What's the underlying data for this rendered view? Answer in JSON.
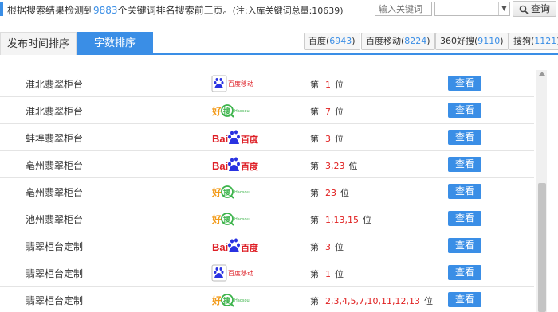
{
  "header": {
    "summary_prefix": "根据搜索结果检测到",
    "keyword_count": "9883",
    "summary_suffix": "个关键词排名搜索前三页。",
    "note": "(注:入库关键词总量:10639)"
  },
  "search": {
    "placeholder": "输入关键词",
    "select_value": "",
    "query_label": "查询"
  },
  "tabs": [
    {
      "label": "发布时间排序",
      "active": false
    },
    {
      "label": "字数排序",
      "active": true
    }
  ],
  "engines": [
    {
      "name": "百度",
      "count": "6943"
    },
    {
      "name": "百度移动",
      "count": "8224"
    },
    {
      "name": "360好搜",
      "count": "9110"
    },
    {
      "name": "搜狗",
      "count": "1121"
    }
  ],
  "rows": [
    {
      "keyword": "淮北翡翠柜台",
      "engine": "baidu-mobile",
      "rank_prefix": "第",
      "positions": "1",
      "rank_suffix": "位",
      "action": "查看"
    },
    {
      "keyword": "淮北翡翠柜台",
      "engine": "haosou",
      "rank_prefix": "第",
      "positions": "7",
      "rank_suffix": "位",
      "action": "查看"
    },
    {
      "keyword": "蚌埠翡翠柜台",
      "engine": "baidu",
      "rank_prefix": "第",
      "positions": "3",
      "rank_suffix": "位",
      "action": "查看"
    },
    {
      "keyword": "亳州翡翠柜台",
      "engine": "baidu",
      "rank_prefix": "第",
      "positions": "3,23",
      "rank_suffix": "位",
      "action": "查看"
    },
    {
      "keyword": "亳州翡翠柜台",
      "engine": "haosou",
      "rank_prefix": "第",
      "positions": "23",
      "rank_suffix": "位",
      "action": "查看"
    },
    {
      "keyword": "池州翡翠柜台",
      "engine": "haosou",
      "rank_prefix": "第",
      "positions": "1,13,15",
      "rank_suffix": "位",
      "action": "查看"
    },
    {
      "keyword": "翡翠柜台定制",
      "engine": "baidu",
      "rank_prefix": "第",
      "positions": "3",
      "rank_suffix": "位",
      "action": "查看"
    },
    {
      "keyword": "翡翠柜台定制",
      "engine": "baidu-mobile",
      "rank_prefix": "第",
      "positions": "1",
      "rank_suffix": "位",
      "action": "查看"
    },
    {
      "keyword": "翡翠柜台定制",
      "engine": "haosou",
      "rank_prefix": "第",
      "positions": "2,3,4,5,7,10,11,12,13",
      "rank_suffix": "位",
      "action": "查看"
    }
  ],
  "logos": {
    "baidu": {
      "text_left": "Bai",
      "text_right": "百度"
    },
    "baidu-mobile": {
      "text": "百度移动"
    },
    "haosou": {
      "text_left": "好",
      "text_mid": "搜",
      "text_small": "Haosou"
    }
  },
  "colors": {
    "accent": "#3a8ee6",
    "rank": "#e02020",
    "baidu_red": "#de1f26",
    "baidu_blue": "#2932e1",
    "haosou_green": "#3bb34a"
  }
}
